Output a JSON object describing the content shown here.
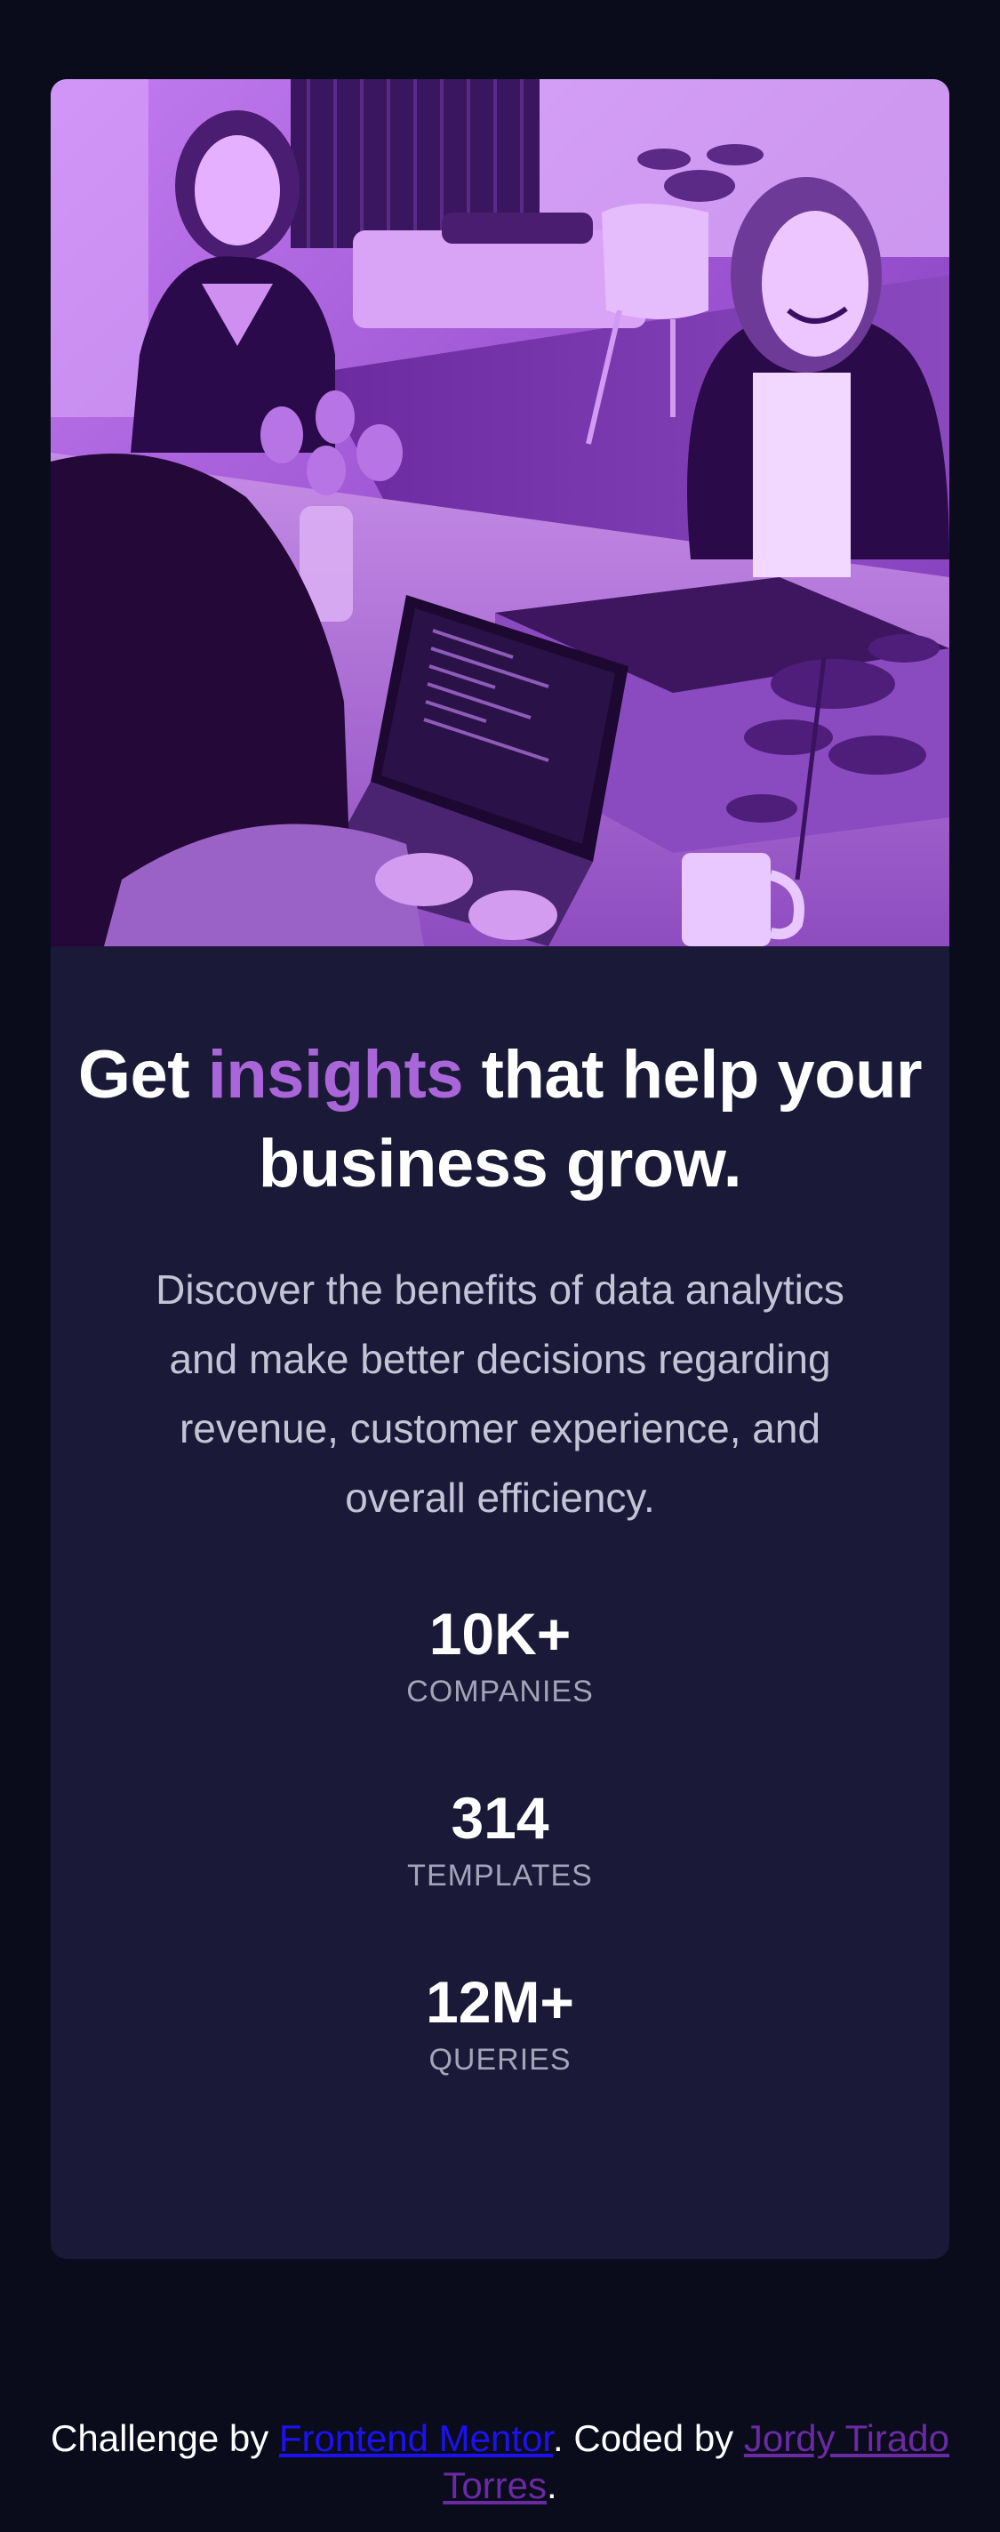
{
  "hero": {
    "image_name": "team-working-photo"
  },
  "headline": {
    "part1": "Get ",
    "accent": "insights",
    "part2": " that help your business grow."
  },
  "description": "Discover the benefits of data analytics and make better decisions regarding revenue, customer experience, and overall efficiency.",
  "stats": [
    {
      "value": "10K+",
      "label": "COMPANIES"
    },
    {
      "value": "314",
      "label": "TEMPLATES"
    },
    {
      "value": "12M+",
      "label": "QUERIES"
    }
  ],
  "footer": {
    "prefix": "Challenge by ",
    "link1": "Frontend Mentor",
    "middle": ". Coded by ",
    "link2": "Jordy Tirado Torres",
    "suffix": "."
  },
  "colors": {
    "background": "#0a0c1c",
    "card": "#1b1938",
    "accent": "#a966d8",
    "text": "#ffffff",
    "muted": "#c5c4d6"
  }
}
